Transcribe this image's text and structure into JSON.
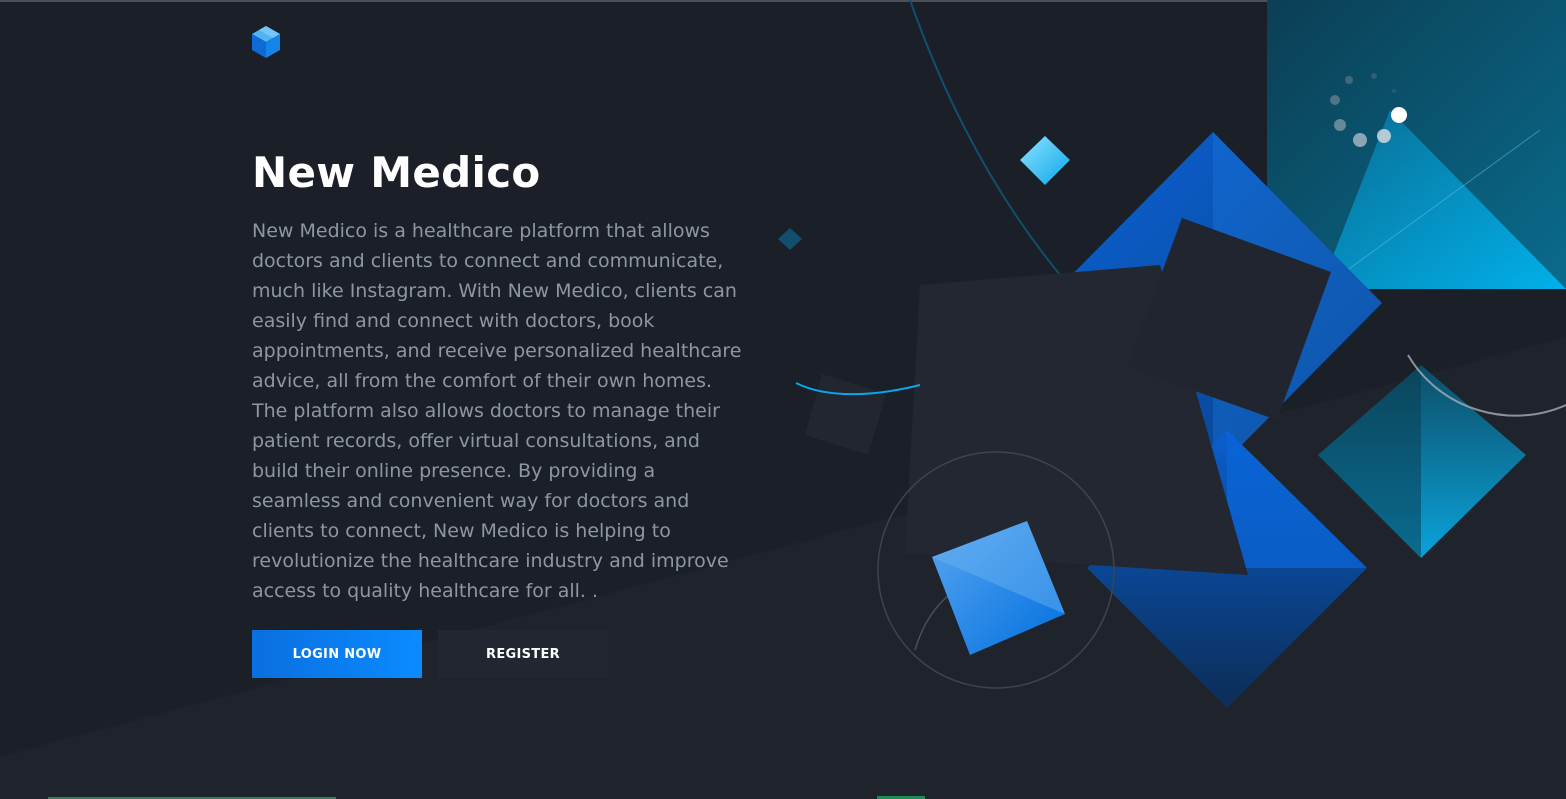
{
  "app": {
    "title": "New Medico",
    "description": "New Medico is a healthcare platform that allows doctors and clients to connect and communicate, much like Instagram. With New Medico, clients can easily find and connect with doctors, book appointments, and receive personalized healthcare advice, all from the comfort of their own homes. The platform also allows doctors to manage their patient records, offer virtual consultations, and build their online presence. By providing a seamless and convenient way for doctors and clients to connect, New Medico is helping to revolutionize the healthcare industry and improve access to quality healthcare for all. ."
  },
  "buttons": {
    "login_label": "LOGIN NOW",
    "register_label": "REGISTER"
  },
  "icons": {
    "logo": "hexagon-cube-logo-icon",
    "loader": "loading-spinner-icon"
  },
  "colors": {
    "background": "#1b1f28",
    "accent": "#0a7cf0",
    "secondary_button": "#222631",
    "text_muted": "#8e96a3"
  }
}
